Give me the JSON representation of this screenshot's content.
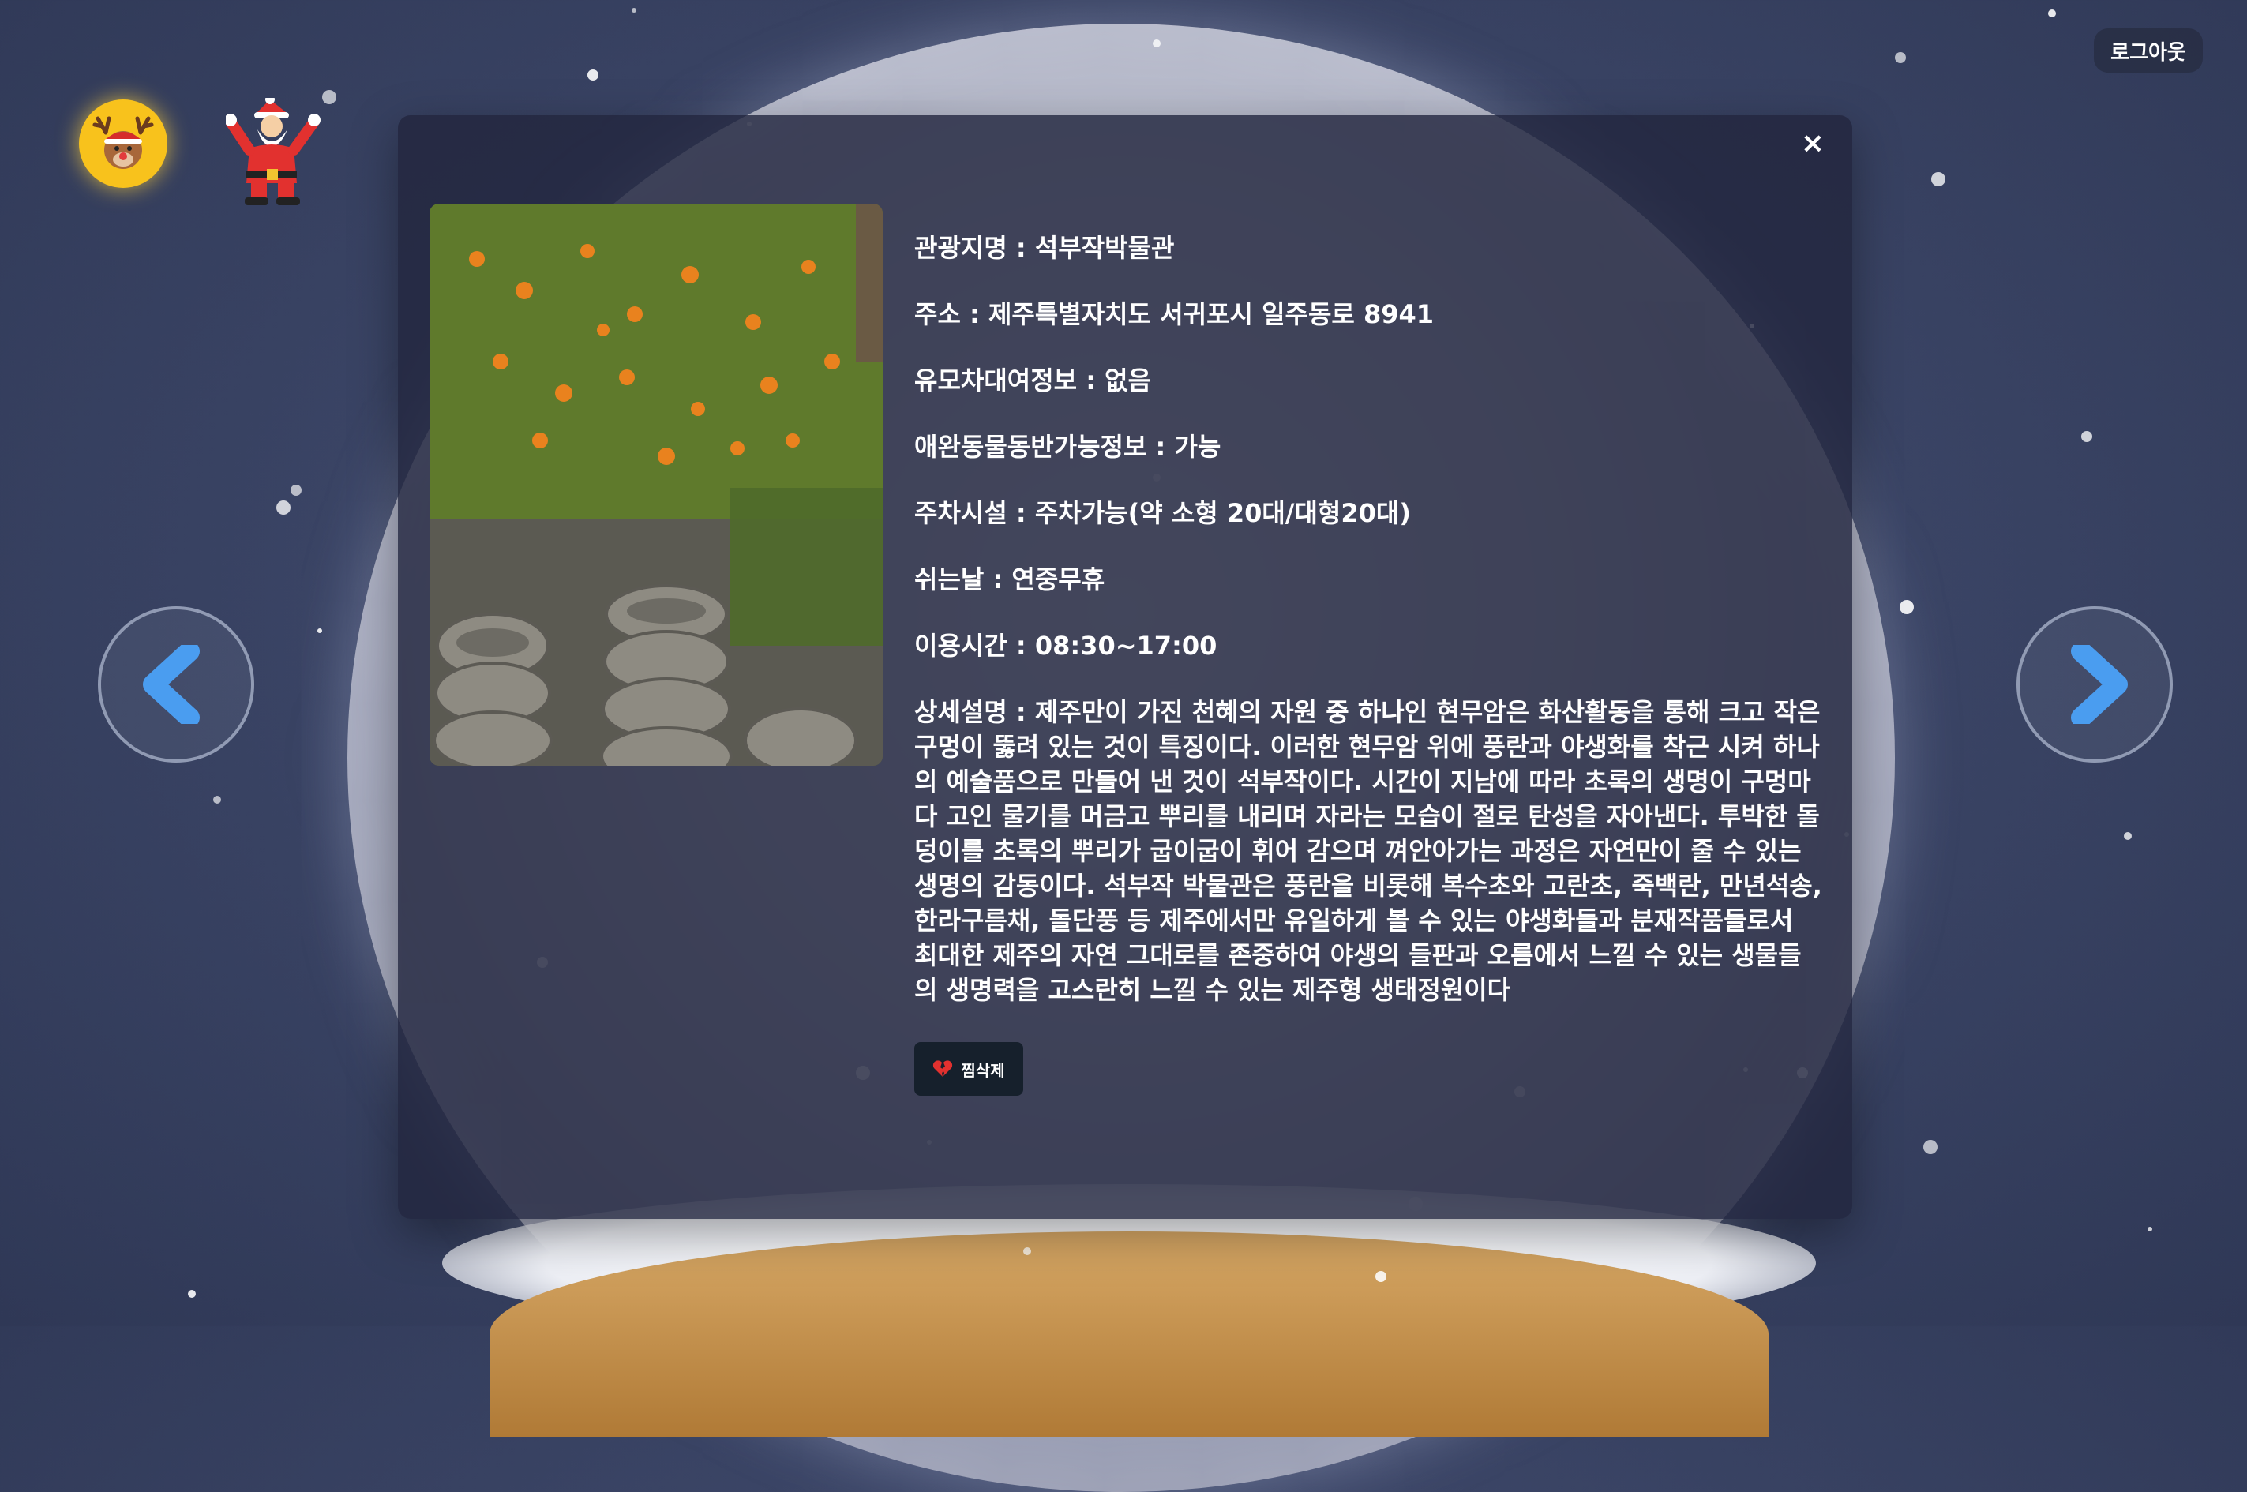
{
  "header": {
    "logout_label": "로그아웃"
  },
  "avatar": {
    "icon": "reindeer-icon"
  },
  "decor": {
    "icon": "santa-icon"
  },
  "navigation": {
    "prev_icon": "chevron-left-icon",
    "next_icon": "chevron-right-icon"
  },
  "modal": {
    "close_label": "×",
    "photo_icon": "tangerine-tree-stone-mortars-photo",
    "fields": [
      {
        "label": "관광지명",
        "value": "석부작박물관"
      },
      {
        "label": "주소",
        "value": "제주특별자치도 서귀포시 일주동로 8941"
      },
      {
        "label": "유모차대여정보",
        "value": "없음"
      },
      {
        "label": "애완동물동반가능정보",
        "value": "가능"
      },
      {
        "label": "주차시설",
        "value": "주차가능(약 소형 20대/대형20대)"
      },
      {
        "label": "쉬는날",
        "value": "연중무휴"
      },
      {
        "label": "이용시간",
        "value": "08:30~17:00"
      }
    ],
    "description": {
      "label": "상세설명",
      "value": "제주만이 가진 천혜의 자원 중 하나인 현무암은 화산활동을 통해 크고 작은 구멍이 뚫려 있는 것이 특징이다. 이러한 현무암 위에 풍란과 야생화를 착근 시켜 하나의 예술품으로 만들어 낸 것이 석부작이다. 시간이 지남에 따라 초록의 생명이 구멍마다 고인 물기를 머금고 뿌리를 내리며 자라는 모습이 절로 탄성을 자아낸다. 투박한 돌덩이를 초록의 뿌리가 굽이굽이 휘어 감으며 껴안아가는 과정은 자연만이 줄 수 있는 생명의 감동이다. 석부작 박물관은 풍란을 비롯해 복수초와 고란초, 죽백란, 만년석송, 한라구름채, 돌단풍 등 제주에서만 유일하게 볼 수 있는 야생화들과 분재작품들로서 최대한 제주의 자연 그대로를 존중하여 야생의 들판과 오름에서 느낄 수 있는 생물들의 생명력을 고스란히 느낄 수 있는 제주형 생태정원이다"
    },
    "unlike_button": {
      "label": "찜삭제",
      "icon": "broken-heart-icon"
    }
  },
  "colors": {
    "accent": "#4a9df0",
    "avatar_bg": "#f8c21c",
    "button_bg": "#16202c"
  }
}
